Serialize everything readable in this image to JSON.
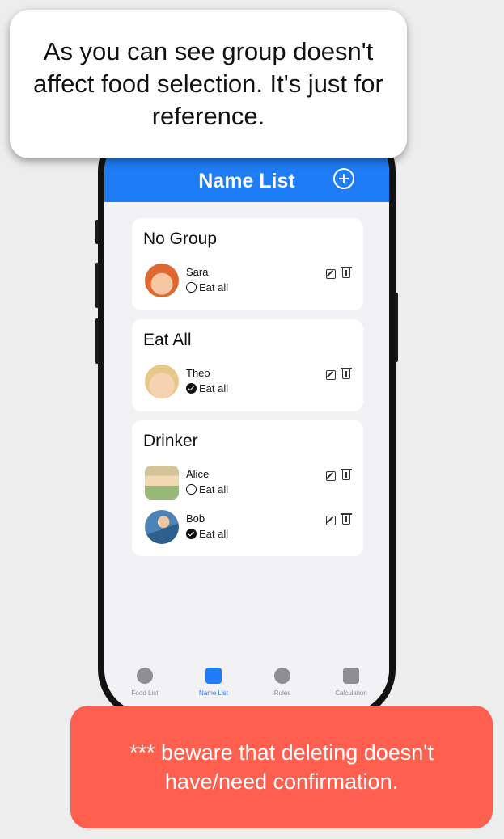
{
  "callouts": {
    "top": "As you can see group doesn't affect food selection. It's just for reference.",
    "bottom": "*** beware that deleting doesn't have/need confirmation."
  },
  "header": {
    "title": "Name List",
    "add_icon": "plus-circle-icon"
  },
  "groups": [
    {
      "title": "No Group",
      "members": [
        {
          "name": "Sara",
          "eat_all_label": "Eat all",
          "eat_all": false
        }
      ]
    },
    {
      "title": "Eat All",
      "members": [
        {
          "name": "Theo",
          "eat_all_label": "Eat all",
          "eat_all": true
        }
      ]
    },
    {
      "title": "Drinker",
      "members": [
        {
          "name": "Alice",
          "eat_all_label": "Eat all",
          "eat_all": false
        },
        {
          "name": "Bob",
          "eat_all_label": "Eat all",
          "eat_all": true
        }
      ]
    }
  ],
  "tabs": [
    {
      "label": "Food List",
      "icon": "fork-knife-icon",
      "active": false
    },
    {
      "label": "Name List",
      "icon": "person-card-icon",
      "active": true
    },
    {
      "label": "Rules",
      "icon": "r-circle-icon",
      "active": false
    },
    {
      "label": "Calculation",
      "icon": "clipboard-list-icon",
      "active": false
    }
  ],
  "colors": {
    "accent": "#1e7cf6",
    "warning": "#ff5f4f"
  }
}
